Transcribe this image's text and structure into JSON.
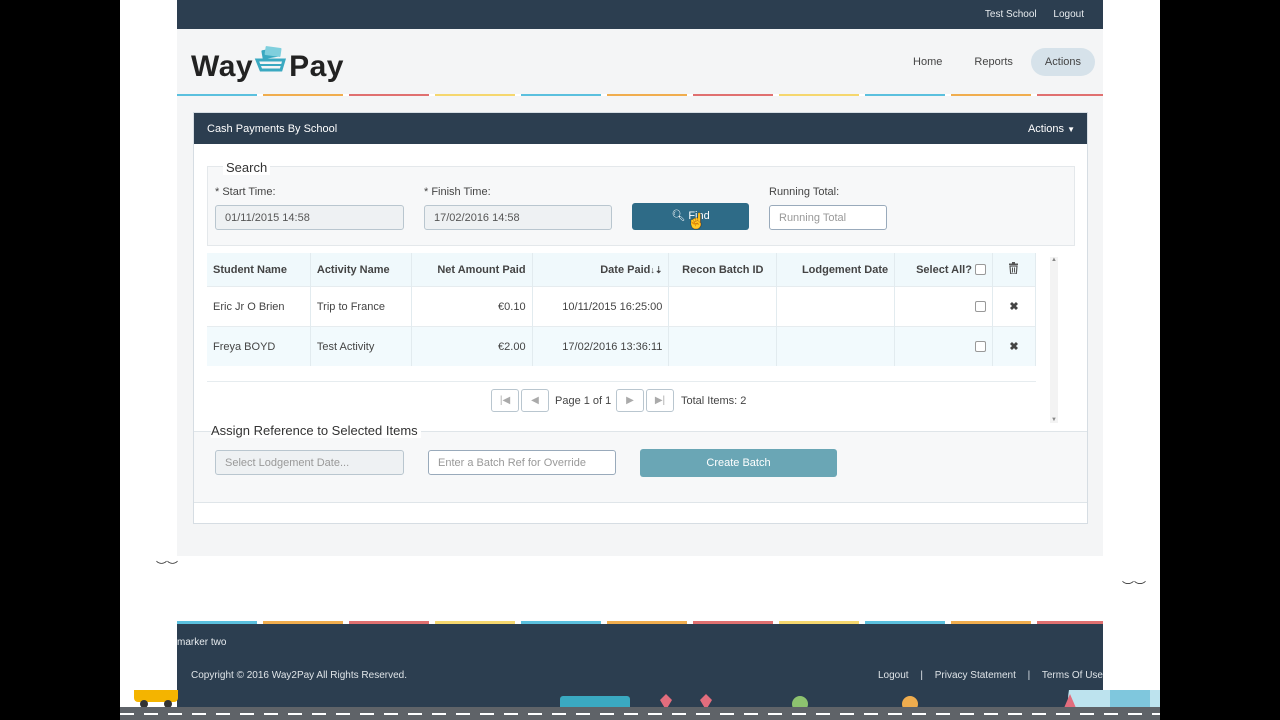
{
  "topbar": {
    "school": "Test School",
    "logout": "Logout"
  },
  "logo": {
    "left": "Way",
    "right": "Pay"
  },
  "nav": {
    "items": [
      "Home",
      "Reports",
      "Actions"
    ],
    "active": "Actions"
  },
  "panel": {
    "title": "Cash Payments By School",
    "actions": "Actions"
  },
  "search": {
    "legend": "Search",
    "start_label": "* Start Time:",
    "start_value": "01/11/2015 14:58",
    "finish_label": "* Finish Time:",
    "finish_value": "17/02/2016 14:58",
    "find_label": "Find",
    "running_label": "Running Total:",
    "running_placeholder": "Running Total"
  },
  "table": {
    "headers": [
      "Student Name",
      "Activity Name",
      "Net Amount Paid",
      "Date Paid",
      "Recon Batch ID",
      "Lodgement Date",
      "Select All?"
    ],
    "rows": [
      {
        "student": "Eric Jr O Brien",
        "activity": "Trip to France",
        "amount": "€0.10",
        "date": "10/11/2015 16:25:00",
        "recon": "",
        "lodgement": ""
      },
      {
        "student": "Freya BOYD",
        "activity": "Test Activity",
        "amount": "€2.00",
        "date": "17/02/2016 13:36:11",
        "recon": "",
        "lodgement": ""
      }
    ]
  },
  "pager": {
    "page_text": "Page 1 of 1",
    "total_text": "Total Items: 2"
  },
  "assign": {
    "legend": "Assign Reference to Selected Items",
    "date_placeholder": "Select Lodgement Date...",
    "batch_placeholder": "Enter a Batch Ref for Override",
    "create_label": "Create Batch"
  },
  "footer": {
    "marker": "marker two",
    "copyright": "Copyright © 2016 Way2Pay All Rights Reserved.",
    "links": [
      "Logout",
      "Privacy Statement",
      "Terms Of Use"
    ]
  },
  "colors": {
    "navy": "#2c3e50",
    "find": "#2e6b87",
    "create": "#6aa6b5",
    "nav_active": "#d6e2ea"
  }
}
